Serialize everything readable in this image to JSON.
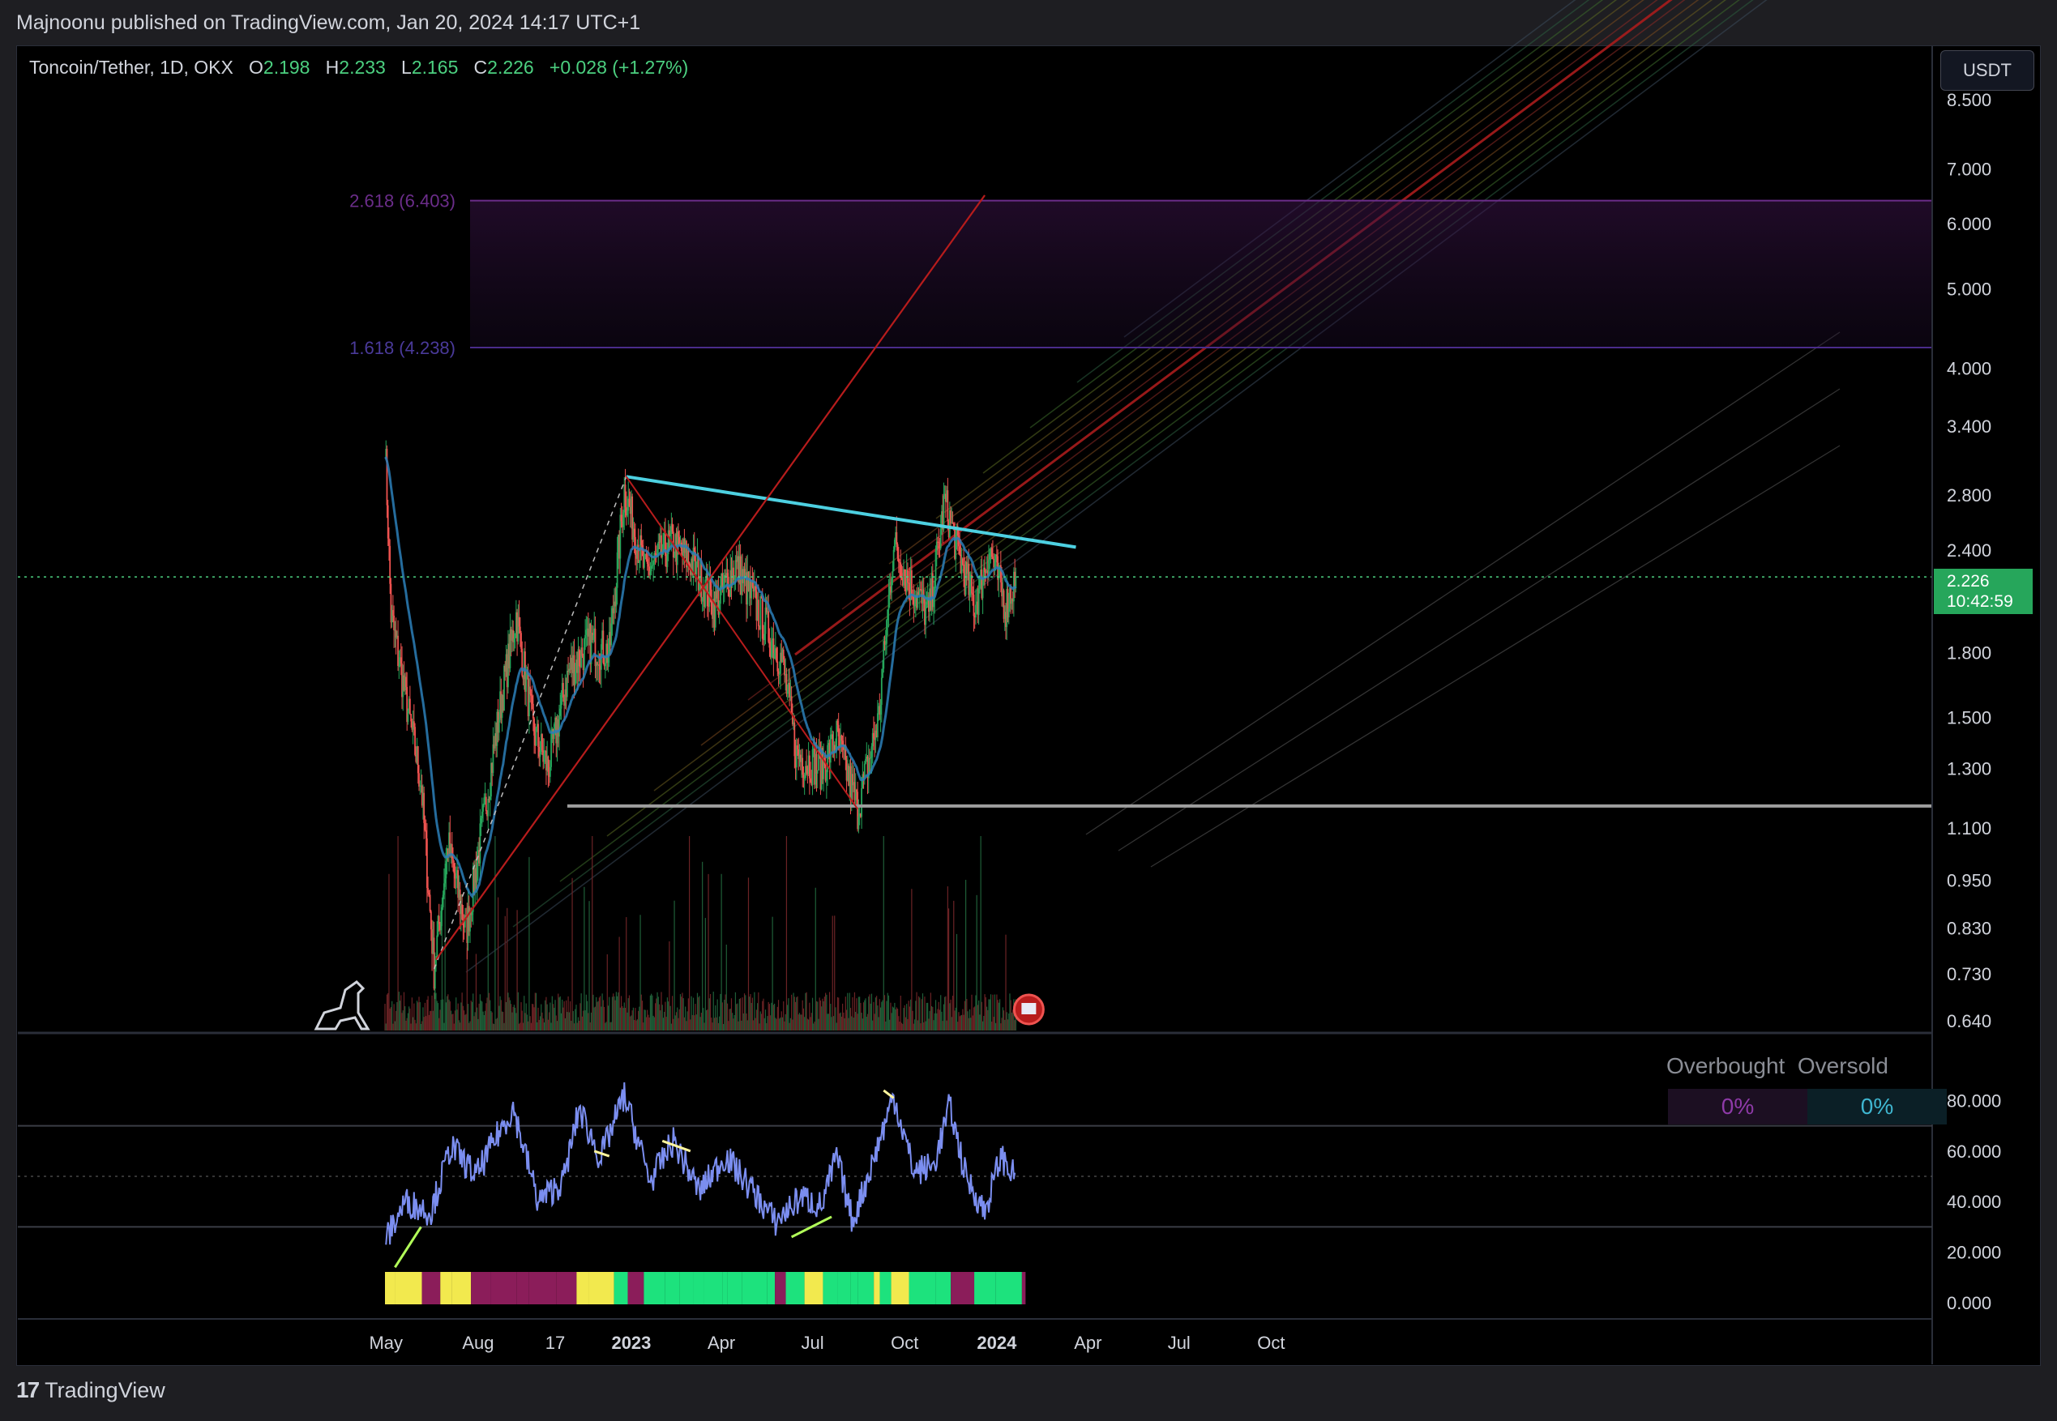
{
  "publisher_line": "Majnoonu published on TradingView.com, Jan 20, 2024 14:17 UTC+1",
  "legend": {
    "symbol": "Toncoin/Tether, 1D, OKX",
    "open_label": "O",
    "open": "2.198",
    "high_label": "H",
    "high": "2.233",
    "low_label": "L",
    "low": "2.165",
    "close_label": "C",
    "close": "2.226",
    "change": "+0.028 (+1.27%)"
  },
  "currency_button": "USDT",
  "last_price": {
    "value": "2.226",
    "countdown": "10:42:59"
  },
  "fib_levels": [
    {
      "label": "2.618 (6.403)",
      "price": 6.403
    },
    {
      "label": "1.618 (4.238)",
      "price": 4.238
    }
  ],
  "rsi_panel": {
    "table_headers": [
      "Overbought",
      "Oversold"
    ],
    "table_values": [
      "0%",
      "0%"
    ],
    "y_ticks": [
      "80.000",
      "60.000",
      "40.000",
      "20.000",
      "0.000"
    ]
  },
  "footer_brand": "TradingView",
  "colors": {
    "up": "#26a65b",
    "down": "#ef5350",
    "trendline": "#4dd0e1",
    "rsi": "#7b8ef0",
    "fib": "#6b3fa0",
    "overbought": "#c266e8",
    "oversold": "#4dd0e1"
  },
  "chart_data": {
    "type": "candlestick",
    "scale": "log",
    "ylim": [
      0.64,
      9.0
    ],
    "y_ticks": [
      8.5,
      7.0,
      6.0,
      5.0,
      4.0,
      3.4,
      2.8,
      2.4,
      1.8,
      1.5,
      1.3,
      1.1,
      0.95,
      0.83,
      0.73,
      0.64
    ],
    "y_tick_labels": [
      "8.500",
      "7.000",
      "6.000",
      "5.000",
      "4.000",
      "3.400",
      "2.800",
      "2.400",
      "1.800",
      "1.500",
      "1.300",
      "1.100",
      "0.950",
      "0.830",
      "0.730",
      "0.640"
    ],
    "x_tick_labels": [
      "May",
      "Aug",
      "17",
      "2023",
      "Apr",
      "Jul",
      "Oct",
      "2024",
      "Apr",
      "Jul",
      "Oct"
    ],
    "x_tick_dates": [
      "2022-05-01",
      "2022-08-01",
      "2022-10-17",
      "2023-01-01",
      "2023-04-01",
      "2023-07-01",
      "2023-10-01",
      "2024-01-01",
      "2024-04-01",
      "2024-07-01",
      "2024-10-01"
    ],
    "close_path": [
      {
        "date": "2022-04-30",
        "close": 3.3
      },
      {
        "date": "2022-05-06",
        "close": 2.0
      },
      {
        "date": "2022-05-20",
        "close": 1.6
      },
      {
        "date": "2022-06-05",
        "close": 1.25
      },
      {
        "date": "2022-06-18",
        "close": 0.74
      },
      {
        "date": "2022-07-02",
        "close": 1.05
      },
      {
        "date": "2022-07-20",
        "close": 0.82
      },
      {
        "date": "2022-08-05",
        "close": 1.1
      },
      {
        "date": "2022-08-25",
        "close": 1.6
      },
      {
        "date": "2022-09-08",
        "close": 2.0
      },
      {
        "date": "2022-09-25",
        "close": 1.45
      },
      {
        "date": "2022-10-10",
        "close": 1.3
      },
      {
        "date": "2022-10-30",
        "close": 1.7
      },
      {
        "date": "2022-11-20",
        "close": 1.85
      },
      {
        "date": "2022-12-10",
        "close": 1.8
      },
      {
        "date": "2022-12-25",
        "close": 2.85
      },
      {
        "date": "2023-01-15",
        "close": 2.25
      },
      {
        "date": "2023-02-10",
        "close": 2.45
      },
      {
        "date": "2023-03-05",
        "close": 2.3
      },
      {
        "date": "2023-03-25",
        "close": 2.05
      },
      {
        "date": "2023-04-15",
        "close": 2.3
      },
      {
        "date": "2023-05-10",
        "close": 2.0
      },
      {
        "date": "2023-06-01",
        "close": 1.75
      },
      {
        "date": "2023-06-15",
        "close": 1.35
      },
      {
        "date": "2023-07-10",
        "close": 1.3
      },
      {
        "date": "2023-07-25",
        "close": 1.42
      },
      {
        "date": "2023-08-15",
        "close": 1.16
      },
      {
        "date": "2023-09-05",
        "close": 1.5
      },
      {
        "date": "2023-09-20",
        "close": 2.45
      },
      {
        "date": "2023-10-05",
        "close": 2.2
      },
      {
        "date": "2023-10-25",
        "close": 2.0
      },
      {
        "date": "2023-11-10",
        "close": 2.75
      },
      {
        "date": "2023-11-25",
        "close": 2.35
      },
      {
        "date": "2023-12-10",
        "close": 2.05
      },
      {
        "date": "2023-12-25",
        "close": 2.4
      },
      {
        "date": "2024-01-10",
        "close": 2.05
      },
      {
        "date": "2024-01-20",
        "close": 2.226
      }
    ],
    "trendline": {
      "start": {
        "date": "2022-12-27",
        "price": 2.95
      },
      "end": {
        "date": "2024-03-20",
        "price": 2.42
      }
    },
    "horizontal_support": 1.17,
    "rsi": {
      "ylim": [
        0,
        100
      ],
      "points": [
        {
          "date": "2022-05-01",
          "value": 25
        },
        {
          "date": "2022-05-20",
          "value": 40
        },
        {
          "date": "2022-06-15",
          "value": 36
        },
        {
          "date": "2022-07-05",
          "value": 62
        },
        {
          "date": "2022-07-30",
          "value": 50
        },
        {
          "date": "2022-08-20",
          "value": 66
        },
        {
          "date": "2022-09-05",
          "value": 77
        },
        {
          "date": "2022-09-30",
          "value": 40
        },
        {
          "date": "2022-10-25",
          "value": 48
        },
        {
          "date": "2022-11-10",
          "value": 77
        },
        {
          "date": "2022-12-01",
          "value": 57
        },
        {
          "date": "2022-12-25",
          "value": 82
        },
        {
          "date": "2023-01-20",
          "value": 48
        },
        {
          "date": "2023-02-12",
          "value": 64
        },
        {
          "date": "2023-03-10",
          "value": 44
        },
        {
          "date": "2023-04-05",
          "value": 58
        },
        {
          "date": "2023-05-01",
          "value": 45
        },
        {
          "date": "2023-05-25",
          "value": 32
        },
        {
          "date": "2023-06-20",
          "value": 42
        },
        {
          "date": "2023-07-10",
          "value": 38
        },
        {
          "date": "2023-07-25",
          "value": 58
        },
        {
          "date": "2023-08-10",
          "value": 32
        },
        {
          "date": "2023-09-01",
          "value": 58
        },
        {
          "date": "2023-09-20",
          "value": 82
        },
        {
          "date": "2023-10-10",
          "value": 52
        },
        {
          "date": "2023-10-30",
          "value": 54
        },
        {
          "date": "2023-11-15",
          "value": 78
        },
        {
          "date": "2023-12-01",
          "value": 50
        },
        {
          "date": "2023-12-20",
          "value": 36
        },
        {
          "date": "2024-01-05",
          "value": 58
        },
        {
          "date": "2024-01-20",
          "value": 49
        }
      ]
    }
  }
}
